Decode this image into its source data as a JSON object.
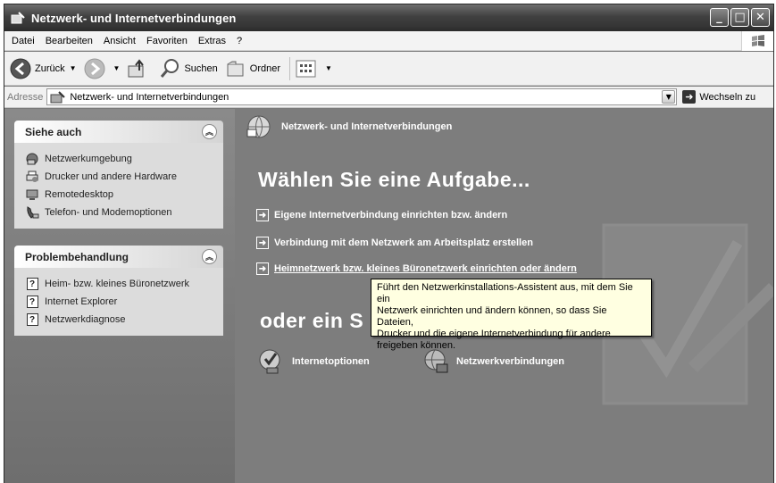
{
  "window": {
    "title": "Netzwerk- und Internetverbindungen",
    "controls": [
      "minimize",
      "maximize",
      "close"
    ]
  },
  "menu": [
    "Datei",
    "Bearbeiten",
    "Ansicht",
    "Favoriten",
    "Extras",
    "?"
  ],
  "toolbar": {
    "back_label": "Zurück",
    "search_label": "Suchen",
    "folders_label": "Ordner"
  },
  "address": {
    "label": "Adresse",
    "value": "Netzwerk- und Internetverbindungen",
    "go_label": "Wechseln zu"
  },
  "see_also": {
    "title": "Siehe auch",
    "items": [
      "Netzwerkumgebung",
      "Drucker und andere Hardware",
      "Remotedesktop",
      "Telefon- und Modemoptionen"
    ]
  },
  "troubleshoot": {
    "title": "Problembehandlung",
    "items": [
      "Heim- bzw. kleines Büronetzwerk",
      "Internet Explorer",
      "Netzwerkdiagnose"
    ]
  },
  "main": {
    "header_title": "Netzwerk- und Internetverbindungen",
    "choose_task": "Wählen Sie eine Aufgabe...",
    "tasks": [
      "Eigene Internetverbindung einrichten bzw. ändern",
      "Verbindung mit dem Netzwerk am Arbeitsplatz erstellen",
      "Heimnetzwerk bzw. kleines Büronetzwerk einrichten oder ändern"
    ],
    "or_pick": "oder ein S",
    "icons": [
      "Internetoptionen",
      "Netzwerkverbindungen"
    ]
  },
  "tooltip": {
    "lines": [
      "Führt den Netzwerkinstallations-Assistent aus, mit dem Sie ein",
      "Netzwerk einrichten und ändern können, so dass Sie Dateien,",
      "Drucker und die eigene Internetverbindung für andere",
      "freigeben können."
    ]
  }
}
